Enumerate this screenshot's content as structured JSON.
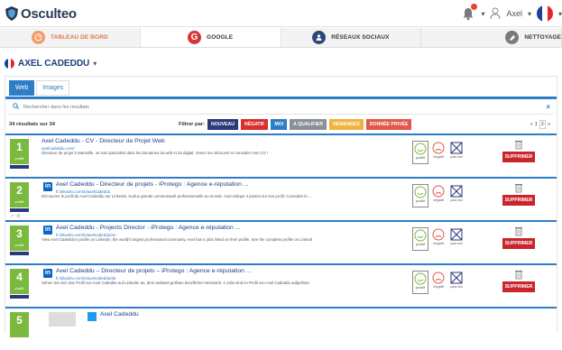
{
  "header": {
    "logo_text": "Osculteo",
    "user_name": "Axel"
  },
  "nav_tabs": [
    {
      "label": "TABLEAU DE BORD",
      "icon": "dashboard-icon",
      "color": "#f29a6a"
    },
    {
      "label": "GOOGLE",
      "icon": "google-icon",
      "color": "#d73434"
    },
    {
      "label": "RÉSEAUX SOCIAUX",
      "icon": "social-network-icon",
      "color": "#2b4a7a"
    },
    {
      "label": "NETTOYAGE",
      "icon": "eraser-icon",
      "color": "#7a7a7a"
    }
  ],
  "person": {
    "name": "AXEL CADEDDU"
  },
  "subtabs": [
    {
      "label": "Web"
    },
    {
      "label": "Images"
    }
  ],
  "search": {
    "placeholder": "Rechercher dans les résultats"
  },
  "results_count": "34 résultats sur 34",
  "filter": {
    "label": "Filtrer par:",
    "buttons": [
      {
        "label": "NOUVEAU",
        "color": "#2b3a7a"
      },
      {
        "label": "NÉGATIF",
        "color": "#d9302e"
      },
      {
        "label": "MOI",
        "color": "#2d7dc7"
      },
      {
        "label": "A QUALIFIER",
        "color": "#8a8f98"
      },
      {
        "label": "DEMANDES",
        "color": "#f0b43c"
      },
      {
        "label": "DONNÉE PRIVÉE",
        "color": "#e2574c"
      }
    ]
  },
  "pager": {
    "prev": "«",
    "first": "1",
    "current": "2",
    "next": "»"
  },
  "vote_labels": {
    "positif": "positif",
    "negatif": "négatif",
    "pasmoi": "pas moi"
  },
  "delete_label": "SUPPRIMER",
  "rank_tag": "positif",
  "results": [
    {
      "rank": "1",
      "title": "Axel Cadeddu - CV - Directeur de Projet Web",
      "url": "axelcadeddu.com/",
      "desc": "Directeur de projet à Marseille. Je suis spécialisé dans les domaines du web et du digital. Venez me découvrir et consulter mon CV !",
      "has_li": false
    },
    {
      "rank": "2",
      "title": "Axel Cadeddu - Directeur de projets - iProtego : Agence e-réputation ...",
      "url": "fr.linkedin.com/in/axelcadeddu",
      "desc": "Découvrez le profil de Axel Cadeddu sur LinkedIn, la plus grande communauté professionnelle au monde. Axel indique 4 postes sur son profil. Consultez le ...",
      "has_li": true,
      "trend": "↗ ↑8"
    },
    {
      "rank": "3",
      "title": "Axel Cadeddu - Projects Director - iProtego : Agence e-réputation ...",
      "url": "fr.linkedin.com/in/axelcadeddu/en",
      "desc": "View Axel Cadeddu's profile on LinkedIn, the world's largest professional community. Axel has 4 jobs listed on their profile. See the complete profile on LinkedIn ...",
      "has_li": true
    },
    {
      "rank": "4",
      "title": "Axel Cadeddu – Directeur de projets – iProtego : Agence e-réputation ...",
      "url": "fr.linkedin.com/in/axelcadeddu/de",
      "desc": "Sehen Sie sich das Profil von Axel Cadeddu auf LinkedIn an, dem weltweit größten beruflichen Netzwerk. 4 Jobs sind im Profil von Axel Cadeddu aufgelistet.",
      "has_li": true
    },
    {
      "rank": "5",
      "title": "Axel Cadeddu",
      "url": "",
      "desc": "",
      "has_li": false
    }
  ]
}
